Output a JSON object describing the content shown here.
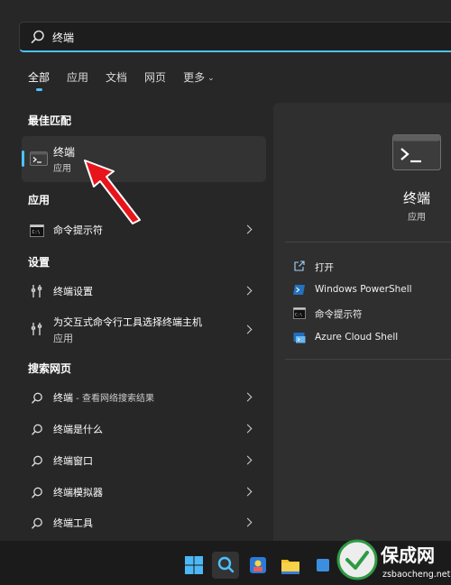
{
  "search": {
    "value": "终端"
  },
  "tabs": [
    {
      "label": "全部"
    },
    {
      "label": "应用"
    },
    {
      "label": "文档"
    },
    {
      "label": "网页"
    },
    {
      "label": "更多"
    }
  ],
  "best_match": {
    "title": "最佳匹配",
    "name": "终端",
    "type": "应用"
  },
  "apps": {
    "title": "应用",
    "items": [
      {
        "label": "命令提示符"
      }
    ]
  },
  "settings": {
    "title": "设置",
    "items": [
      {
        "label": "终端设置"
      },
      {
        "label": "为交互式命令行工具选择终端主机",
        "sub": "应用"
      }
    ]
  },
  "web": {
    "title": "搜索网页",
    "items": [
      {
        "label": "终端",
        "suffix": " - 查看网络搜索结果"
      },
      {
        "label": "终端是什么"
      },
      {
        "label": "终端窗口"
      },
      {
        "label": "终端模拟器"
      },
      {
        "label": "终端工具"
      }
    ]
  },
  "detail": {
    "name": "终端",
    "type": "应用",
    "actions": [
      {
        "label": "打开",
        "icon": "open-icon"
      },
      {
        "label": "Windows PowerShell",
        "icon": "powershell-icon"
      },
      {
        "label": "命令提示符",
        "icon": "cmd-icon"
      },
      {
        "label": "Azure Cloud Shell",
        "icon": "azure-cloud-shell-icon"
      }
    ]
  },
  "watermark": {
    "brand": "保成网",
    "url": "zsbaocheng.net"
  },
  "colors": {
    "accent": "#4cc2ff",
    "panel": "#272727",
    "arrow": "#e8141c"
  }
}
